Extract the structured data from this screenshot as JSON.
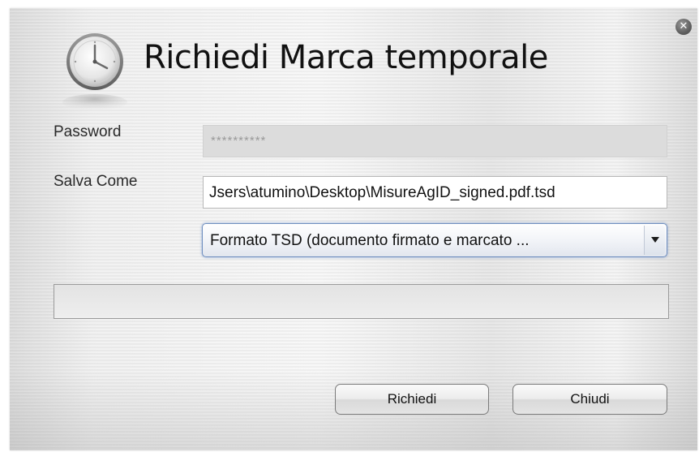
{
  "dialog": {
    "title": "Richiedi Marca temporale",
    "close_icon": "close-icon"
  },
  "header": {
    "icon": "clock-icon"
  },
  "form": {
    "password_label": "Password",
    "password_value": "**********",
    "save_as_label": "Salva Come",
    "save_as_value": "Jsers\\atumino\\Desktop\\MisureAgID_signed.pdf.tsd",
    "format_selected": "Formato TSD (documento firmato e marcato ...",
    "format_arrow_icon": "chevron-down-icon"
  },
  "progress": {
    "value": 0
  },
  "buttons": {
    "request_label": "Richiedi",
    "close_label": "Chiudi"
  }
}
